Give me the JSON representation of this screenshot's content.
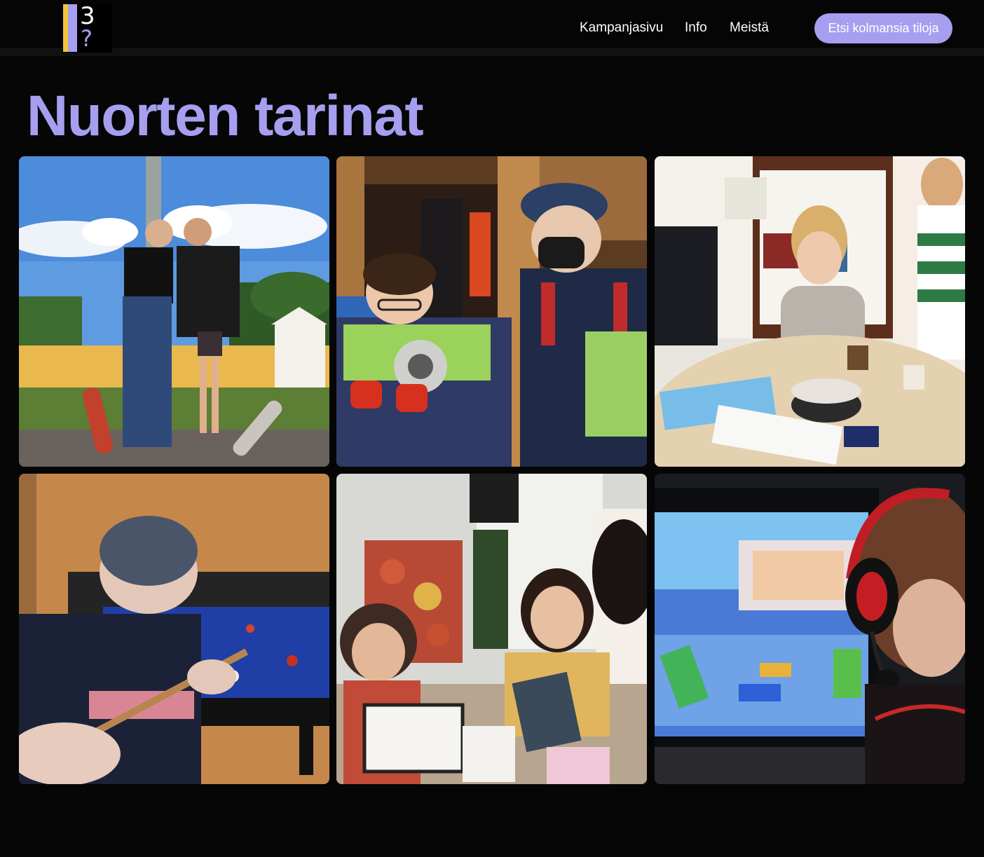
{
  "header": {
    "logo": {
      "digit_top": "3",
      "digit_bottom": "?",
      "colors": [
        "#f3c43a",
        "#a69ff0"
      ]
    },
    "nav": [
      {
        "label": "Kampanjasivu"
      },
      {
        "label": "Info"
      },
      {
        "label": "Meistä"
      }
    ],
    "cta_label": "Etsi kolmansia tiloja"
  },
  "main": {
    "title": "Nuorten tarinat",
    "photos": [
      {
        "subject": "skateboarders-outdoor"
      },
      {
        "subject": "fire-safety-workshop"
      },
      {
        "subject": "library-drawing-table"
      },
      {
        "subject": "billiards-player"
      },
      {
        "subject": "art-fair"
      },
      {
        "subject": "gamer-headset"
      }
    ]
  },
  "colors": {
    "accent": "#a69ff0",
    "logo_yellow": "#f3c43a",
    "background": "#060606"
  }
}
